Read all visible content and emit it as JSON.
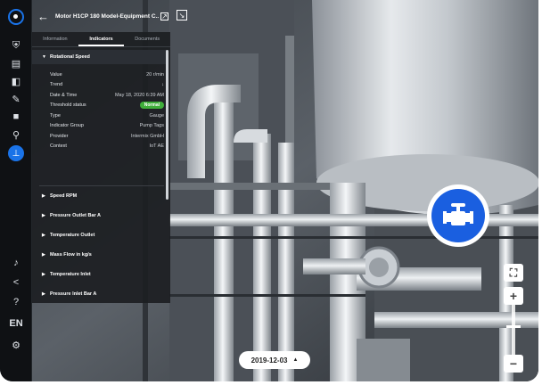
{
  "header": {
    "title": "Motor H1CP 180 Model-Equipment C..."
  },
  "sidebar": {
    "icons": [
      "shield-icon",
      "chat-icon",
      "book-icon",
      "ruler-icon",
      "video-icon",
      "search-icon",
      "valve-icon",
      "bell-icon",
      "share-icon",
      "help-icon",
      "settings-icon"
    ],
    "language": "EN"
  },
  "panel": {
    "tabs": [
      "Information",
      "Indicators",
      "Documents"
    ],
    "active_tab": "Indicators",
    "open_section": "Rotational Speed",
    "details": [
      {
        "label": "Value",
        "value": "20 r/min"
      },
      {
        "label": "Trend",
        "value": "↓"
      },
      {
        "label": "Date & Time",
        "value": "May 18, 2020 6:39 AM"
      },
      {
        "label": "Threshold status",
        "value": "Normal"
      },
      {
        "label": "Type",
        "value": "Gauge"
      },
      {
        "label": "Indicator Group",
        "value": "Pump Tags"
      },
      {
        "label": "Provider",
        "value": "Intermix GmbH"
      },
      {
        "label": "Context",
        "value": "IoT AE"
      }
    ],
    "sections": [
      "Speed RPM",
      "Pressure Outlet Bar A",
      "Temperature Outlet",
      "Mass Flow in kg/s",
      "Temperature Inlet",
      "Pressure Inlet Bar A"
    ]
  },
  "timeline": {
    "date": "2019-12-03"
  },
  "zoom": {
    "plus_label": "+",
    "minus_label": "−",
    "level": 0.6
  },
  "colors": {
    "accent": "#1a5fe0",
    "normal_badge": "#3fae3a"
  }
}
